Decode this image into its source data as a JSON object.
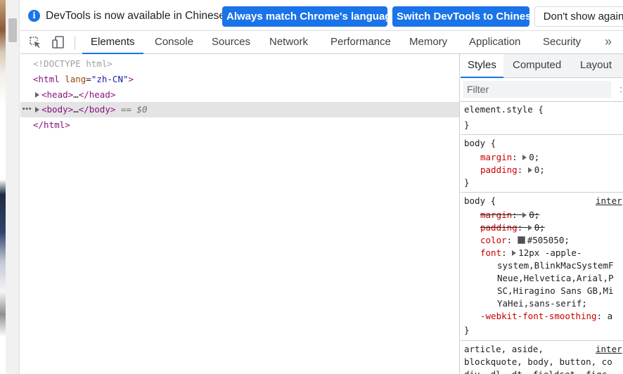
{
  "infobar": {
    "message": "DevTools is now available in Chinese!",
    "match_button": "Always match Chrome's language",
    "switch_button": "Switch DevTools to Chinese",
    "dismiss_button": "Don't show again"
  },
  "toolbar": {
    "tabs": [
      "Elements",
      "Console",
      "Sources",
      "Network",
      "Performance",
      "Memory",
      "Application",
      "Security"
    ],
    "active_tab": "Elements",
    "more_label": "»"
  },
  "dom": {
    "doctype": "<!DOCTYPE html>",
    "html_open_tag": "<html",
    "html_attr_name": "lang",
    "html_attr_value": "\"zh-CN\"",
    "html_open_end": ">",
    "head_tag_open": "<head>",
    "head_ellipsis": "…",
    "head_tag_close": "</head>",
    "body_dots": "•••",
    "body_tag_open": "<body>",
    "body_ellipsis": "…",
    "body_tag_close": "</body>",
    "body_ref": "== $0",
    "html_close": "</html>"
  },
  "styles": {
    "sub_tabs": [
      "Styles",
      "Computed",
      "Layout"
    ],
    "active_sub_tab": "Styles",
    "filter_placeholder": "Filter",
    "filter_more": ":",
    "element_style_selector": "element.style {",
    "close_brace": "}",
    "rule1": {
      "selector": "body {",
      "margin_prop": "margin",
      "margin_val": "0;",
      "padding_prop": "padding",
      "padding_val": "0;"
    },
    "rule2": {
      "selector": "body {",
      "source": "inter",
      "margin_prop": "margin",
      "margin_val": "0;",
      "padding_prop": "padding",
      "padding_val": "0;",
      "color_prop": "color",
      "color_val": "#505050;",
      "font_prop": "font",
      "font_val_lines": [
        "12px -apple-",
        "system,BlinkMacSystemF",
        "Neue,Helvetica,Arial,P",
        "SC,Hiragino Sans GB,Mi",
        "YaHei,sans-serif;"
      ],
      "smoothing_prop": "-webkit-font-smoothing",
      "smoothing_val": "a"
    },
    "rule3": {
      "selector_line1": "article, aside,",
      "source": "inter",
      "selector_line2": "blockquote, body, button, co",
      "selector_line3": "div, dl, dt, fieldset, figc"
    }
  },
  "colors": {
    "accent": "#1a73e8",
    "swatch": "#505050"
  }
}
